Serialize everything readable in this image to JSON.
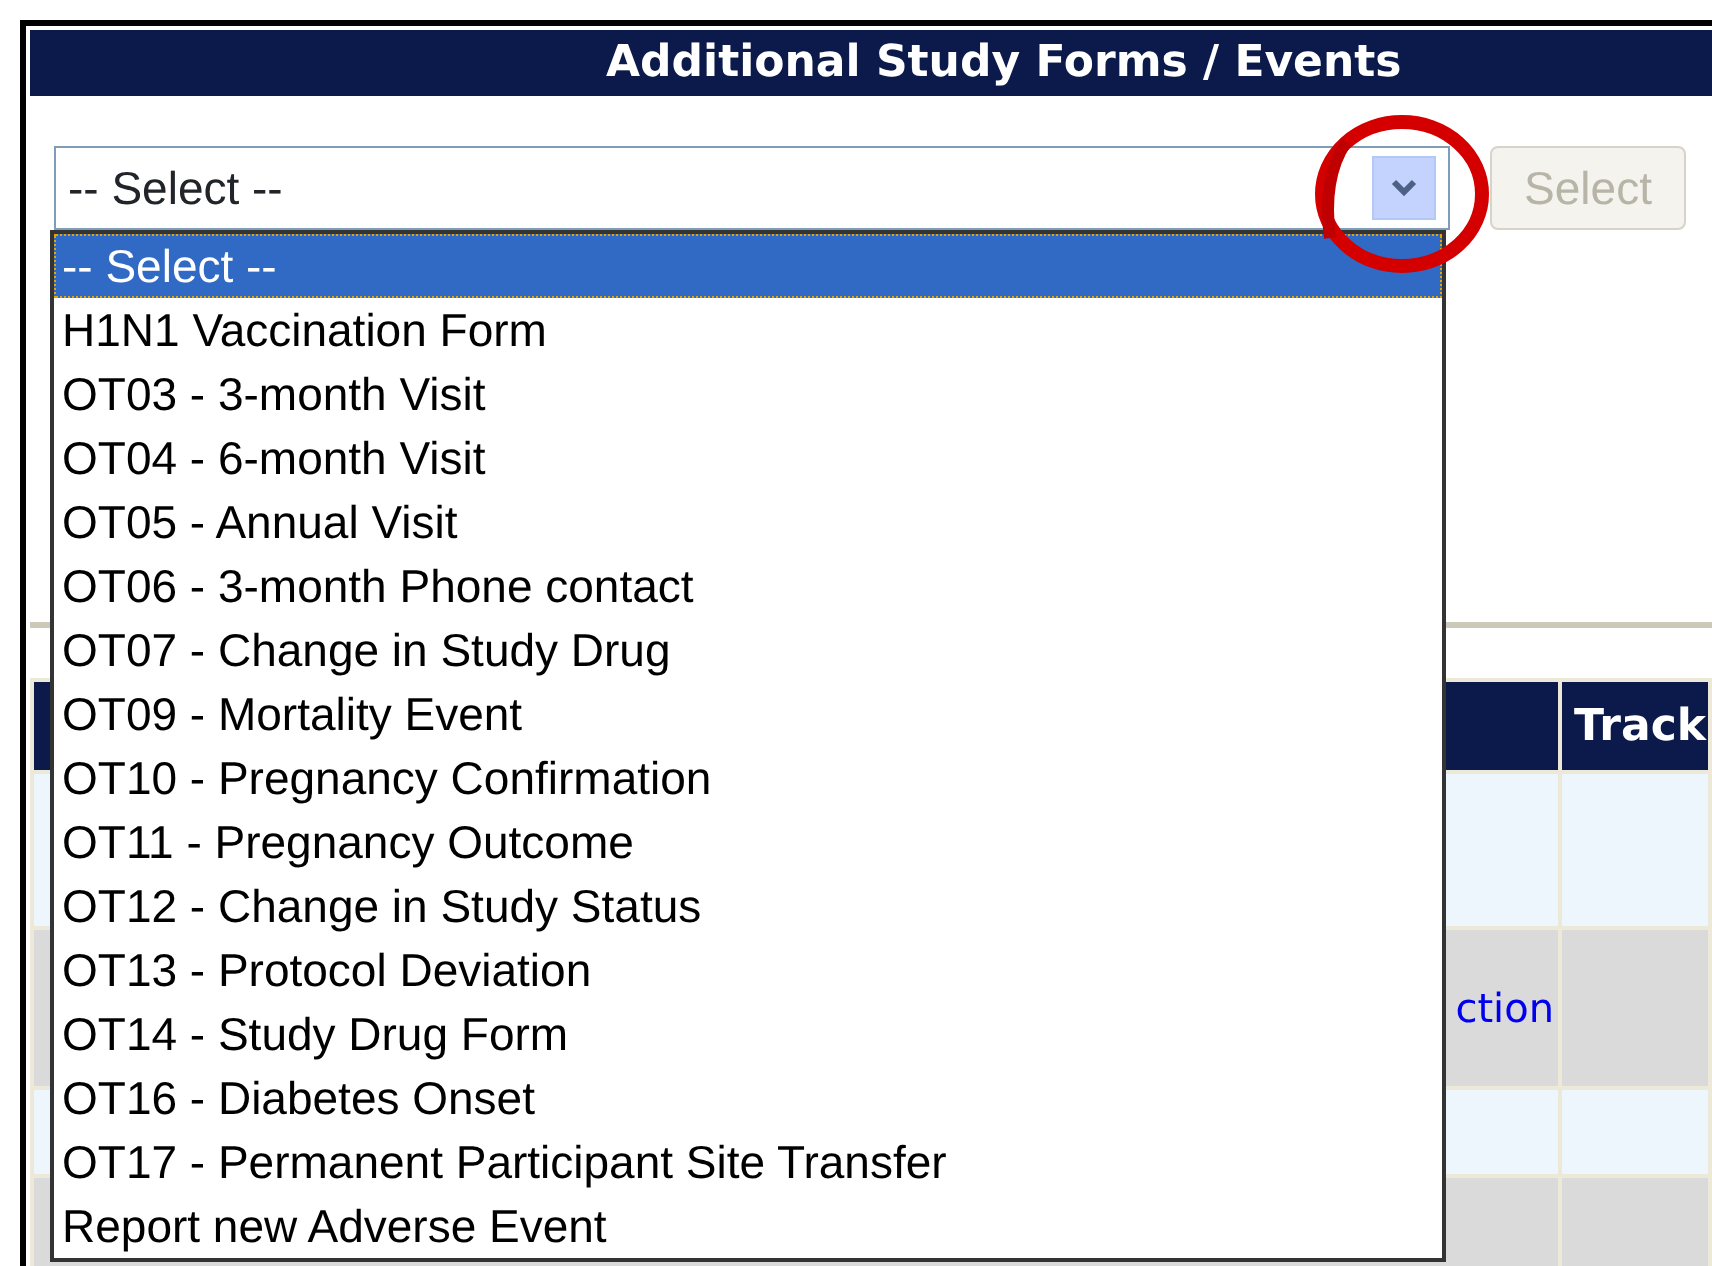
{
  "header": {
    "title": "Additional Study Forms / Events"
  },
  "form_select": {
    "value": "-- Select --",
    "expanded": true
  },
  "select_button": {
    "label": "Select",
    "disabled": true
  },
  "dropdown_options": [
    {
      "label": "-- Select --",
      "selected": true
    },
    {
      "label": "H1N1 Vaccination Form",
      "selected": false
    },
    {
      "label": "OT03 - 3-month Visit",
      "selected": false
    },
    {
      "label": "OT04 - 6-month Visit",
      "selected": false
    },
    {
      "label": "OT05 - Annual Visit",
      "selected": false
    },
    {
      "label": "OT06 - 3-month Phone contact",
      "selected": false
    },
    {
      "label": "OT07 - Change in Study Drug",
      "selected": false
    },
    {
      "label": "OT09 - Mortality Event",
      "selected": false
    },
    {
      "label": "OT10 - Pregnancy Confirmation",
      "selected": false
    },
    {
      "label": "OT11 - Pregnancy Outcome",
      "selected": false
    },
    {
      "label": "OT12 - Change in Study Status",
      "selected": false
    },
    {
      "label": "OT13 - Protocol Deviation",
      "selected": false
    },
    {
      "label": "OT14 - Study Drug Form",
      "selected": false
    },
    {
      "label": "OT16 - Diabetes Onset",
      "selected": false
    },
    {
      "label": "OT17 - Permanent Participant Site Transfer",
      "selected": false
    },
    {
      "label": "Report new Adverse Event",
      "selected": false
    }
  ],
  "table": {
    "column_2_header": "Track",
    "row_2_link": "ction"
  }
}
